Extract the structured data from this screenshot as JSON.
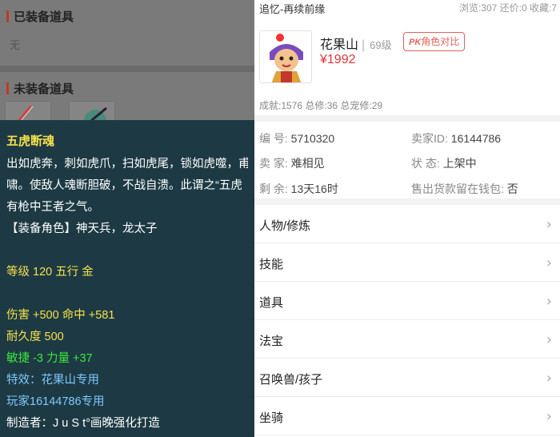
{
  "left": {
    "equipped_title": "已装备道具",
    "equipped_none": "无",
    "unequipped_title": "未装备道具",
    "tooltip": {
      "name": "五虎断魂",
      "desc": [
        "出如虎奔，刺如虎爪，扫如虎尾，锁如虎噬，甫",
        "啸。使敌人魂断胆破，不战自溃。此谓之“五虎",
        "有枪中王者之气。"
      ],
      "roles": "【装备角色】神天兵，龙太子",
      "level": "等级 120 五行 金",
      "damage": "伤害 +500 命中 +581",
      "durability": "耐久度 500",
      "agility": "敏捷 -3 力量 +37",
      "special": "特效：花果山专用",
      "player": "玩家16144786专用",
      "maker": "制造者：J u S t°画晚强化打造"
    }
  },
  "right": {
    "title": "追忆-再续前缘",
    "stats": "浏览:307 还价:0 收藏:7",
    "server": "花果山",
    "level": "69级",
    "compare_prefix": "PK",
    "compare_label": "角色对比",
    "price": "¥1992",
    "achievements": "成就:1576 总修:36 总宠修:29",
    "info": {
      "id_label": "编  号: ",
      "id_value": "5710320",
      "seller_id_label": "卖家ID: ",
      "seller_id_value": "16144786",
      "seller_label": "卖  家: ",
      "seller_value": "难相见",
      "status_label": "状  态: ",
      "status_value": "上架中",
      "remain_label": "剩  余: ",
      "remain_value": "13天16时",
      "wallet_label": "售出货款留在钱包: ",
      "wallet_value": "否"
    },
    "menu": [
      "人物/修炼",
      "技能",
      "道具",
      "法宝",
      "召唤兽/孩子",
      "坐骑"
    ]
  }
}
